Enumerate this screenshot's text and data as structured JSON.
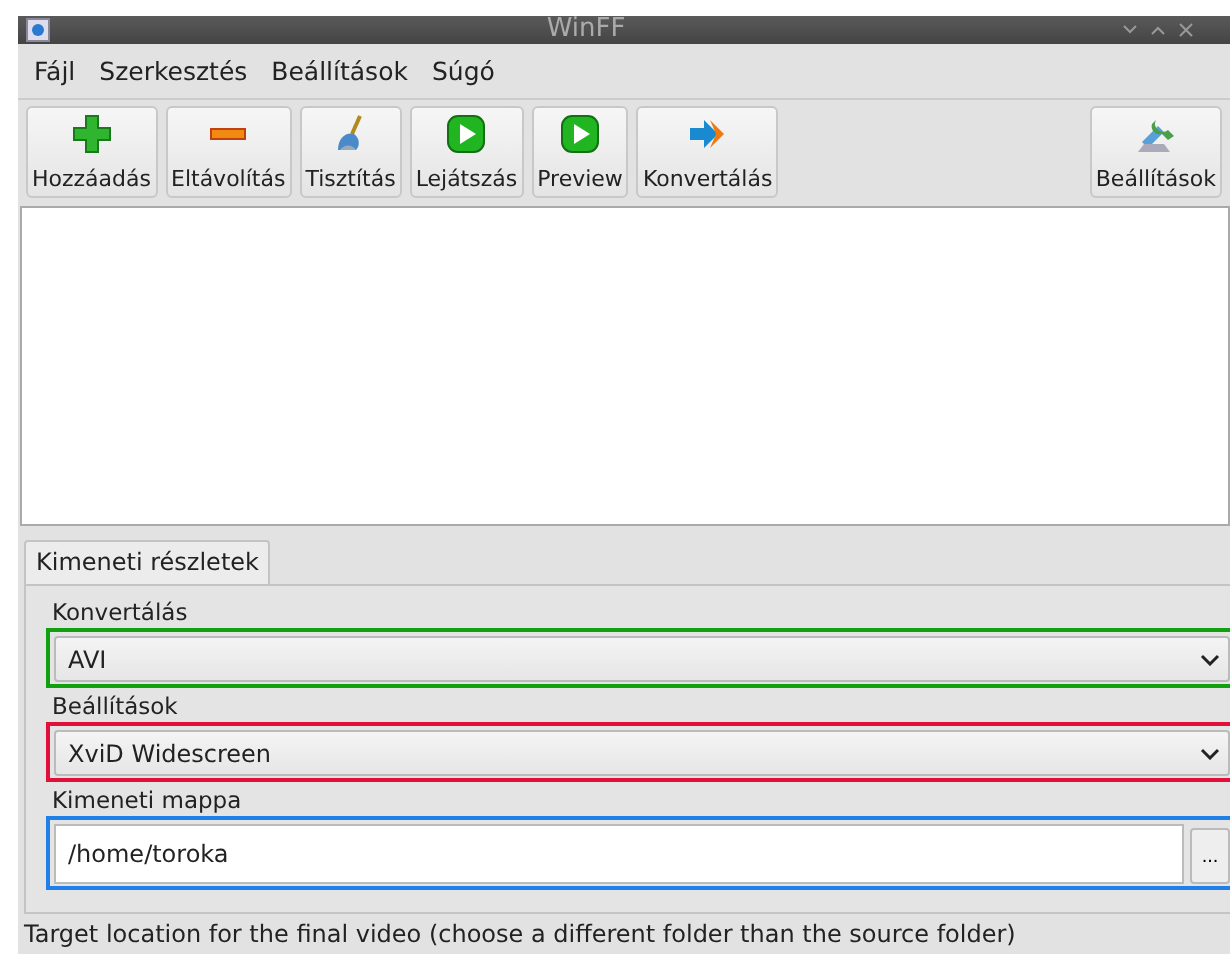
{
  "window": {
    "title": "WinFF"
  },
  "menu": [
    "Fájl",
    "Szerkesztés",
    "Beállítások",
    "Súgó"
  ],
  "toolbar": [
    {
      "label": "Hozzáadás",
      "kind": "add"
    },
    {
      "label": "Eltávolítás",
      "kind": "remove"
    },
    {
      "label": "Tisztítás",
      "kind": "clear"
    },
    {
      "label": "Lejátszás",
      "kind": "play"
    },
    {
      "label": "Preview",
      "kind": "play"
    },
    {
      "label": "Konvertálás",
      "kind": "convert"
    }
  ],
  "toolbar_right": {
    "label": "Beállítások",
    "kind": "settings"
  },
  "tabs": [
    {
      "label": "Kimeneti részletek",
      "selected": true
    }
  ],
  "fields": [
    {
      "label": "Konvertálás",
      "kind": "select",
      "value": "AVI",
      "color": "#10a010"
    },
    {
      "label": "Beállítások",
      "kind": "select",
      "value": "XviD Widescreen",
      "color": "#e0103a"
    },
    {
      "label": "Kimeneti mappa",
      "kind": "folder",
      "value": "/home/toroka",
      "button": "...",
      "color": "#2080e8"
    }
  ],
  "status_bar": "Target location for the final video (choose a different folder than the source folder)"
}
